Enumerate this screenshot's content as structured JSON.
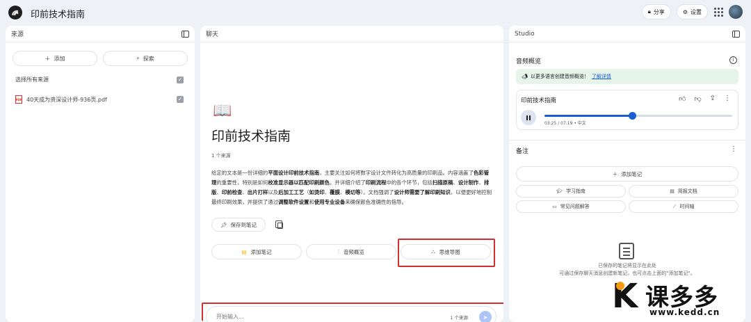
{
  "header": {
    "title": "印前技术指南",
    "share_label": "分享",
    "settings_label": "设置"
  },
  "sources": {
    "title": "来源",
    "add_label": "添加",
    "discover_label": "探索",
    "select_all_label": "选择所有来源",
    "items": [
      {
        "name": "40天成为资深设计师-936页.pdf",
        "checked": true
      }
    ]
  },
  "chat": {
    "title": "聊天",
    "book_emoji": "📖",
    "notebook_title": "印前技术指南",
    "source_count": "1 个来源",
    "summary_parts": [
      {
        "text": "给定的文本是一份详细的",
        "bold": false
      },
      {
        "text": "平面设计印前技术指南",
        "bold": true
      },
      {
        "text": "，主要关注如何将数字设计文件转化为高质量的印刷品。内容涵盖了",
        "bold": false
      },
      {
        "text": "色彩管理",
        "bold": true
      },
      {
        "text": "的重要性，特别是如何",
        "bold": false
      },
      {
        "text": "校准显示器以匹配印刷颜色",
        "bold": true
      },
      {
        "text": "，并详细介绍了",
        "bold": false
      },
      {
        "text": "印刷流程",
        "bold": true
      },
      {
        "text": "中的各个环节，包括",
        "bold": false
      },
      {
        "text": "扫描原稿",
        "bold": true
      },
      {
        "text": "、",
        "bold": false
      },
      {
        "text": "设计制作",
        "bold": true
      },
      {
        "text": "、",
        "bold": false
      },
      {
        "text": "排版",
        "bold": true
      },
      {
        "text": "、",
        "bold": false
      },
      {
        "text": "印前检查",
        "bold": true
      },
      {
        "text": "、",
        "bold": false
      },
      {
        "text": "出片打样",
        "bold": true
      },
      {
        "text": "以及",
        "bold": false
      },
      {
        "text": "后加工工艺",
        "bold": true
      },
      {
        "text": "（",
        "bold": false
      },
      {
        "text": "如烫印",
        "bold": true
      },
      {
        "text": "、",
        "bold": false
      },
      {
        "text": "覆膜",
        "bold": true
      },
      {
        "text": "、",
        "bold": false
      },
      {
        "text": "模切等",
        "bold": true
      },
      {
        "text": "）。文档强调了",
        "bold": false
      },
      {
        "text": "设计师需要了解印刷知识",
        "bold": true
      },
      {
        "text": "，以便更好地控制最终印刷效果，并提供了通过",
        "bold": false
      },
      {
        "text": "调整软件设置",
        "bold": true
      },
      {
        "text": "和",
        "bold": false
      },
      {
        "text": "使用专业设备",
        "bold": true
      },
      {
        "text": "来确保颜色准确性的指导。",
        "bold": false
      }
    ],
    "save_note_label": "保存到笔记",
    "actions": {
      "add_note": "添加笔记",
      "audio_overview": "音频概览",
      "mind_map": "思维导图"
    },
    "input_placeholder": "开始输入...",
    "input_source_count": "1 个来源"
  },
  "studio": {
    "title": "Studio",
    "audio_section_title": "音频概览",
    "banner_text": "以更多语言创建音频概览！",
    "banner_link": "了解详情",
    "audio": {
      "title": "印前技术指南",
      "time": "03:25 / 07:19 • 中文",
      "progress": 0.467
    },
    "notes_title": "备注",
    "add_note_label": "添加笔记",
    "note_buttons": [
      "学习指南",
      "简报文档",
      "常见问题解答",
      "时间轴"
    ],
    "empty_line1": "已保存的笔记将显示在此处",
    "empty_line2": "可通过保存聊天消息创建新笔记，也可点击上面的\"添加笔记\"。"
  },
  "watermark": {
    "cn": "课多多",
    "url": "www.kedd.cn"
  },
  "colors": {
    "accent": "#1a5fd0",
    "highlight": "#d32f2f",
    "banner_bg": "#e6f4ea"
  }
}
